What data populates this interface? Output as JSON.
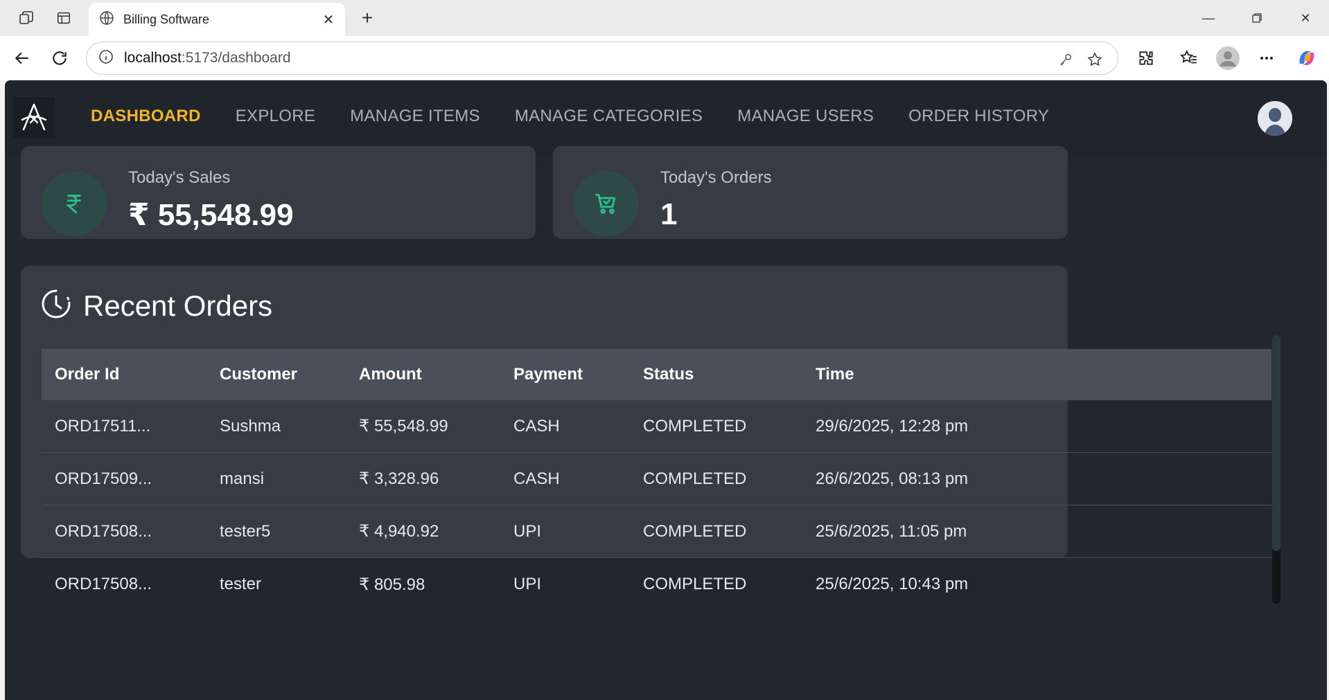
{
  "browser": {
    "tab_title": "Billing Software",
    "url_host": "localhost",
    "url_rest": ":5173/dashboard"
  },
  "nav": {
    "links": [
      "DASHBOARD",
      "EXPLORE",
      "MANAGE ITEMS",
      "MANAGE CATEGORIES",
      "MANAGE USERS",
      "ORDER HISTORY"
    ],
    "active": "DASHBOARD"
  },
  "stats": {
    "sales": {
      "label": "Today's Sales",
      "value": "₹ 55,548.99",
      "icon": "rupee-icon"
    },
    "orders": {
      "label": "Today's Orders",
      "value": "1",
      "icon": "cart-icon"
    }
  },
  "recent_orders": {
    "title": "Recent Orders",
    "columns": [
      "Order Id",
      "Customer",
      "Amount",
      "Payment",
      "Status",
      "Time"
    ],
    "rows": [
      [
        "ORD17511...",
        "Sushma",
        "₹ 55,548.99",
        "CASH",
        "COMPLETED",
        "29/6/2025, 12:28 pm"
      ],
      [
        "ORD17509...",
        "mansi",
        "₹ 3,328.96",
        "CASH",
        "COMPLETED",
        "26/6/2025, 08:13 pm"
      ],
      [
        "ORD17508...",
        "tester5",
        "₹ 4,940.92",
        "UPI",
        "COMPLETED",
        "25/6/2025, 11:05 pm"
      ],
      [
        "ORD17508...",
        "tester",
        "₹ 805.98",
        "UPI",
        "COMPLETED",
        "25/6/2025, 10:43 pm"
      ]
    ]
  },
  "colors": {
    "accent": "#f0b429",
    "icon_green": "#2fbf8c",
    "card_bg": "#363b44",
    "app_bg": "#22272e"
  }
}
